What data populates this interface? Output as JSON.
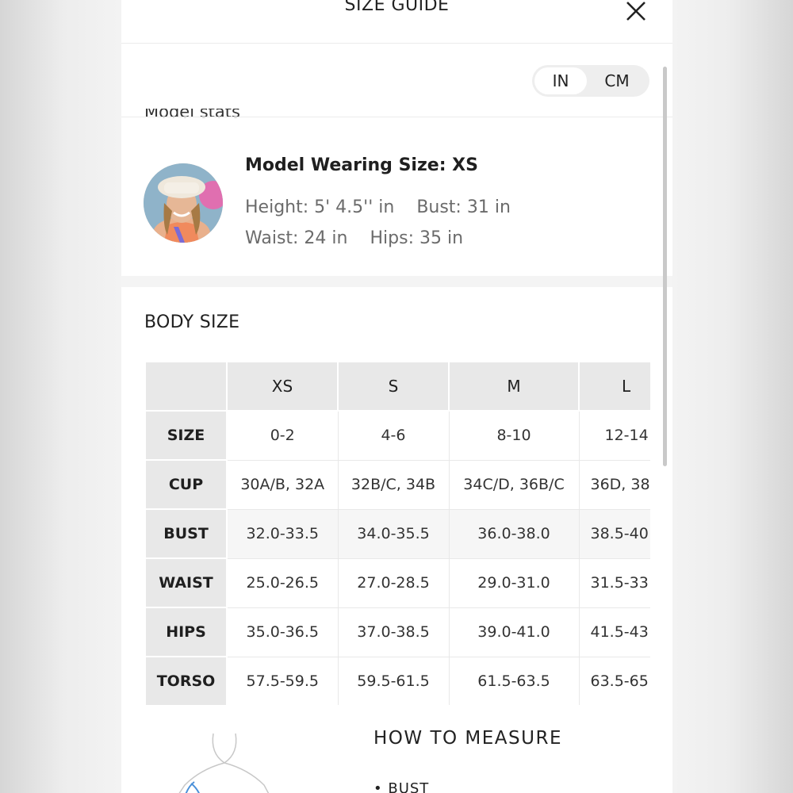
{
  "header": {
    "title": "SIZE GUIDE",
    "close_icon": "close-icon"
  },
  "units": {
    "options": [
      "IN",
      "CM"
    ],
    "selected": "IN"
  },
  "model_stats": {
    "heading": "Model stats",
    "wearing": "Model Wearing Size: XS",
    "height": "Height: 5' 4.5'' in",
    "bust": "Bust: 31 in",
    "waist": "Waist: 24 in",
    "hips": "Hips: 35 in"
  },
  "body_size": {
    "title": "BODY SIZE",
    "columns": [
      "XS",
      "S",
      "M",
      "L"
    ],
    "rows": [
      {
        "label": "SIZE",
        "values": [
          "0-2",
          "4-6",
          "8-10",
          "12-14"
        ]
      },
      {
        "label": "CUP",
        "values": [
          "30A/B, 32A",
          "32B/C, 34B",
          "34C/D, 36B/C",
          "36D, 38"
        ]
      },
      {
        "label": "BUST",
        "values": [
          "32.0-33.5",
          "34.0-35.5",
          "36.0-38.0",
          "38.5-40"
        ]
      },
      {
        "label": "WAIST",
        "values": [
          "25.0-26.5",
          "27.0-28.5",
          "29.0-31.0",
          "31.5-33"
        ]
      },
      {
        "label": "HIPS",
        "values": [
          "35.0-36.5",
          "37.0-38.5",
          "39.0-41.0",
          "41.5-43"
        ]
      },
      {
        "label": "TORSO",
        "values": [
          "57.5-59.5",
          "59.5-61.5",
          "61.5-63.5",
          "63.5-65"
        ]
      }
    ]
  },
  "how_to_measure": {
    "title": "HOW TO MEASURE",
    "items": [
      "BUST"
    ]
  },
  "colors": {
    "header_cell": "#e8e8e8",
    "muted_text": "#6b6b6b",
    "accent_line": "#4a90d9"
  }
}
